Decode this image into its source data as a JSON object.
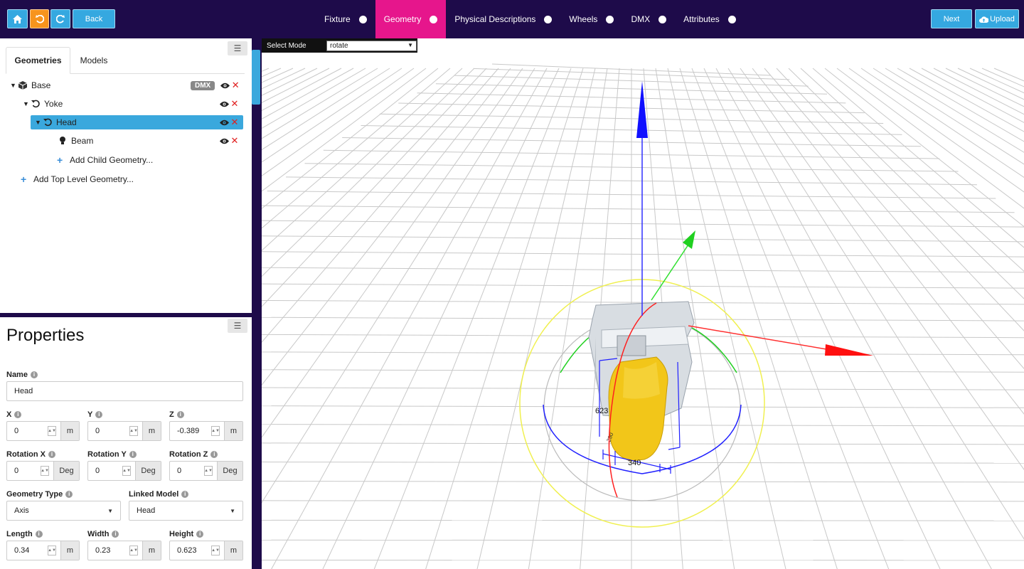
{
  "toolbar": {
    "home_icon": "home-icon",
    "undo_icon": "undo-icon",
    "redo_icon": "redo-icon",
    "back_label": "Back",
    "next_label": "Next",
    "upload_label": "Upload"
  },
  "nav": {
    "items": [
      {
        "label": "Fixture",
        "active": false
      },
      {
        "label": "Geometry",
        "active": true
      },
      {
        "label": "Physical Descriptions",
        "active": false
      },
      {
        "label": "Wheels",
        "active": false
      },
      {
        "label": "DMX",
        "active": false
      },
      {
        "label": "Attributes",
        "active": false
      }
    ]
  },
  "geometries_panel": {
    "tabs": [
      "Geometries",
      "Models"
    ],
    "active_tab": "Geometries",
    "tree": [
      {
        "label": "Base",
        "icon": "cube-icon",
        "badge": "DMX"
      },
      {
        "label": "Yoke",
        "icon": "rotate-icon"
      },
      {
        "label": "Head",
        "icon": "rotate-icon",
        "selected": true
      },
      {
        "label": "Beam",
        "icon": "bulb-icon"
      }
    ],
    "add_child": "Add Child Geometry...",
    "add_top": "Add Top Level Geometry..."
  },
  "properties": {
    "title": "Properties",
    "name_label": "Name",
    "name_value": "Head",
    "x_label": "X",
    "x_value": "0",
    "x_unit": "m",
    "y_label": "Y",
    "y_value": "0",
    "y_unit": "m",
    "z_label": "Z",
    "z_value": "-0.389",
    "z_unit": "m",
    "rx_label": "Rotation X",
    "rx_value": "0",
    "rx_unit": "Deg",
    "ry_label": "Rotation Y",
    "ry_value": "0",
    "ry_unit": "Deg",
    "rz_label": "Rotation Z",
    "rz_value": "0",
    "rz_unit": "Deg",
    "geometry_type_label": "Geometry Type",
    "geometry_type_value": "Axis",
    "linked_model_label": "Linked Model",
    "linked_model_value": "Head",
    "length_label": "Length",
    "length_value": "0.34",
    "length_unit": "m",
    "width_label": "Width",
    "width_value": "0.23",
    "width_unit": "m",
    "height_label": "Height",
    "height_value": "0.623",
    "height_unit": "m"
  },
  "viewport": {
    "select_mode_label": "Select Mode",
    "select_mode_value": "rotate",
    "dim_height": "623",
    "dim_length": "340",
    "dim_width": "230"
  },
  "colors": {
    "topbar": "#1e0b4a",
    "accent_blue": "#35a8e0",
    "accent_orange": "#f7941d",
    "nav_active": "#e6168c",
    "axis_x": "#ff2020",
    "axis_y": "#20d020",
    "axis_z": "#1010ff",
    "model_yellow": "#f2c619"
  }
}
